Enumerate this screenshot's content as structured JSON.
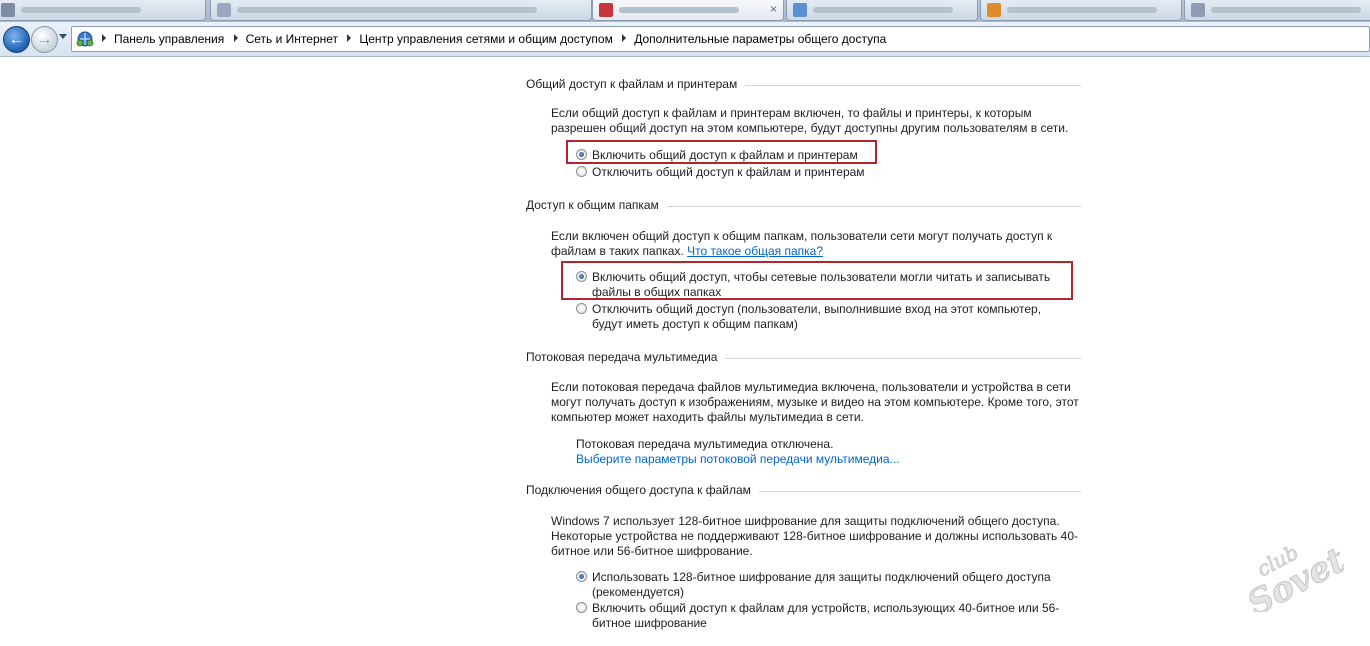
{
  "breadcrumb": {
    "items": [
      "Панель управления",
      "Сеть и Интернет",
      "Центр управления сетями и общим доступом",
      "Дополнительные параметры общего доступа"
    ]
  },
  "icons": {
    "back": "back-arrow-icon",
    "forward": "forward-arrow-icon",
    "network": "network-icon"
  },
  "sections": {
    "file_printer": {
      "heading": "Общий доступ к файлам и принтерам",
      "description": "Если общий доступ к файлам и принтерам включен, то файлы и принтеры, к которым разрешен общий доступ на этом компьютере, будут доступны другим пользователям в сети.",
      "option_on": "Включить общий доступ к файлам и принтерам",
      "option_off": "Отключить общий доступ к файлам и принтерам",
      "selected": "on"
    },
    "public_folders": {
      "heading": "Доступ к общим папкам",
      "description": "Если включен общий доступ к общим папкам, пользователи сети могут получать доступ к файлам в таких папках.",
      "link": "Что такое общая папка?",
      "option_on": "Включить общий доступ, чтобы сетевые пользователи могли читать и записывать файлы в общих папках",
      "option_off": "Отключить общий доступ (пользователи, выполнившие вход на этот компьютер, будут иметь доступ к общим папкам)",
      "selected": "on"
    },
    "media": {
      "heading": "Потоковая передача мультимедиа",
      "description": "Если потоковая передача файлов мультимедиа включена, пользователи и устройства в сети могут получать доступ к изображениям, музыке и видео на этом компьютере. Кроме того, этот компьютер может находить файлы мультимедиа в сети.",
      "status": "Потоковая передача мультимедиа отключена.",
      "link": "Выберите параметры потоковой передачи мультимедиа..."
    },
    "connections": {
      "heading": "Подключения общего доступа к файлам",
      "description": "Windows 7 использует 128-битное шифрование для защиты подключений общего доступа. Некоторые устройства не поддерживают 128-битное шифрование и должны использовать 40-битное или 56-битное шифрование.",
      "option_128": "Использовать 128-битное шифрование для защиты подключений общего доступа (рекомендуется)",
      "option_40_56": "Включить общий доступ к файлам для устройств, использующих 40-битное или 56-битное шифрование",
      "selected": "128"
    }
  },
  "colors": {
    "highlight_border": "#b3242c",
    "link": "#0066cc"
  },
  "watermark": {
    "text": "club Sovet"
  }
}
